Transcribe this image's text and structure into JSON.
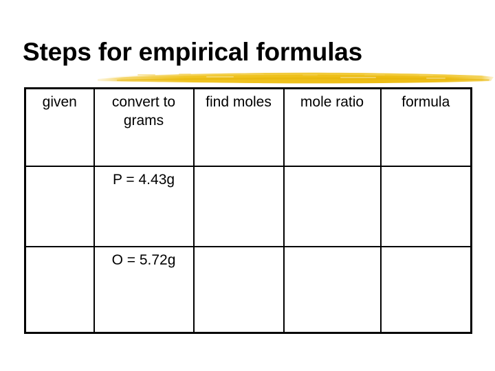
{
  "slide": {
    "title": "Steps for empirical formulas",
    "background_color": "#ffffff",
    "text_color": "#000000"
  },
  "decoration": {
    "brush_stroke": {
      "name": "yellow-highlight-stroke",
      "color": "#efc41e",
      "color_light": "#f7d85a",
      "color_dark": "#e0ae0c"
    }
  },
  "table": {
    "border_color": "#000000",
    "columns": [
      {
        "key": "given",
        "label": "given"
      },
      {
        "key": "convert",
        "label": "convert to grams"
      },
      {
        "key": "find_moles",
        "label": "find moles"
      },
      {
        "key": "mole_ratio",
        "label": "mole ratio"
      },
      {
        "key": "formula",
        "label": "formula"
      }
    ],
    "headers": [
      "given",
      "convert to\ngrams",
      "find\nmoles",
      "mole ratio",
      "formula"
    ],
    "rows": [
      {
        "given": "",
        "convert": "P  =  4.43g",
        "find_moles": "",
        "mole_ratio": "",
        "formula": ""
      },
      {
        "given": "",
        "convert": "O  =  5.72g",
        "find_moles": "",
        "mole_ratio": "",
        "formula": ""
      }
    ]
  }
}
